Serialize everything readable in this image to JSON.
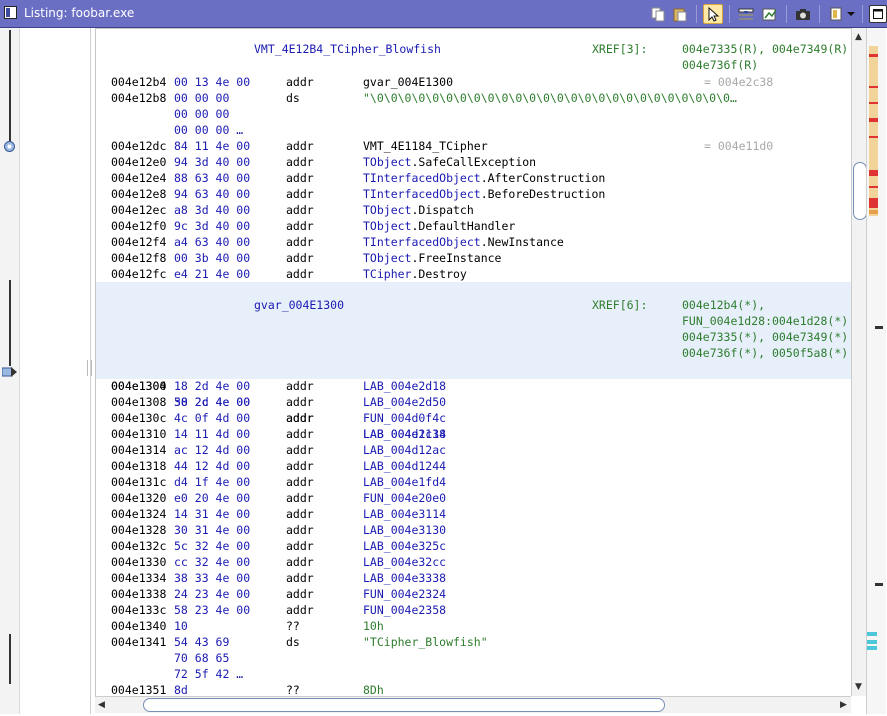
{
  "window": {
    "title": "Listing:  foobar.exe"
  },
  "toolbar": {
    "buttons": [
      {
        "name": "copy-icon"
      },
      {
        "name": "paste-icon"
      },
      {
        "name": "cursor-select-icon"
      },
      {
        "name": "edit-fields-icon"
      },
      {
        "name": "diff-icon"
      },
      {
        "name": "snapshot-icon"
      },
      {
        "name": "display-options-icon"
      },
      {
        "name": "dropdown-icon"
      },
      {
        "name": "maximize-icon"
      },
      {
        "name": "close-icon"
      }
    ]
  },
  "listing": {
    "label1": {
      "name": "VMT_4E12B4_TCipher_Blowfish",
      "xref_head": "XREF[3]:",
      "xref_lines": [
        "004e7335(R), 004e7349(R)",
        "004e736f(R)"
      ]
    },
    "rows_a": [
      {
        "addr": "004e12b4",
        "bytes": "00 13 4e 00",
        "mnem": "addr",
        "oper": "gvar_004E1300",
        "comment": "= 004e2c38"
      },
      {
        "addr": "004e12b8",
        "bytes": "00 00 00",
        "mnem": "ds",
        "oper": "\"\\0\\0\\0\\0\\0\\0\\0\\0\\0\\0\\0\\0\\0\\0\\0\\0\\0\\0\\0\\0\\0\\0\\0\\0\\0\\0…",
        "comment": ""
      },
      {
        "addr": "",
        "bytes": "00 00 00",
        "mnem": "",
        "oper": "",
        "comment": ""
      },
      {
        "addr": "",
        "bytes": "00 00 00 …",
        "mnem": "",
        "oper": "",
        "comment": ""
      },
      {
        "addr": "004e12dc",
        "bytes": "84 11 4e 00",
        "mnem": "addr",
        "oper": "VMT_4E1184_TCipher",
        "comment": "= 004e11d0"
      },
      {
        "addr": "004e12e0",
        "bytes": "94 3d 40 00",
        "mnem": "addr",
        "oper_ns": "TObject",
        "oper_fn": ".SafeCallException",
        "comment": ""
      },
      {
        "addr": "004e12e4",
        "bytes": "88 63 40 00",
        "mnem": "addr",
        "oper_ns": "TInterfacedObject",
        "oper_fn": ".AfterConstruction",
        "comment": ""
      },
      {
        "addr": "004e12e8",
        "bytes": "94 63 40 00",
        "mnem": "addr",
        "oper_ns": "TInterfacedObject",
        "oper_fn": ".BeforeDestruction",
        "comment": ""
      },
      {
        "addr": "004e12ec",
        "bytes": "a8 3d 40 00",
        "mnem": "addr",
        "oper_ns": "TObject",
        "oper_fn": ".Dispatch",
        "comment": ""
      },
      {
        "addr": "004e12f0",
        "bytes": "9c 3d 40 00",
        "mnem": "addr",
        "oper_ns": "TObject",
        "oper_fn": ".DefaultHandler",
        "comment": ""
      },
      {
        "addr": "004e12f4",
        "bytes": "a4 63 40 00",
        "mnem": "addr",
        "oper_ns": "TInterfacedObject",
        "oper_fn": ".NewInstance",
        "comment": ""
      },
      {
        "addr": "004e12f8",
        "bytes": "00 3b 40 00",
        "mnem": "addr",
        "oper_ns": "TObject",
        "oper_fn": ".FreeInstance",
        "comment": ""
      },
      {
        "addr": "004e12fc",
        "bytes": "e4 21 4e 00",
        "mnem": "addr",
        "oper_ns": "TCipher",
        "oper_fn": ".Destroy",
        "comment": ""
      }
    ],
    "label2": {
      "name": "gvar_004E1300",
      "xref_head": "XREF[6]:",
      "xref_lines": [
        "004e12b4(*),",
        "FUN_004e1d28:004e1d28(*)",
        "004e7335(*), 004e7349(*)",
        "004e736f(*), 0050f5a8(*)"
      ]
    },
    "row_hl": {
      "addr": "004e1300",
      "bytes": "38 2c 4e 00",
      "mnem": "addr",
      "oper": "LAB_004e2c38"
    },
    "rows_b": [
      {
        "addr": "004e1304",
        "bytes": "18 2d 4e 00",
        "mnem": "addr",
        "oper": "LAB_004e2d18"
      },
      {
        "addr": "004e1308",
        "bytes": "50 2d 4e 00",
        "mnem": "addr",
        "oper": "LAB_004e2d50"
      },
      {
        "addr": "004e130c",
        "bytes": "4c 0f 4d 00",
        "mnem": "addr",
        "oper": "FUN_004d0f4c"
      },
      {
        "addr": "004e1310",
        "bytes": "14 11 4d 00",
        "mnem": "addr",
        "oper": "LAB_004d1114"
      },
      {
        "addr": "004e1314",
        "bytes": "ac 12 4d 00",
        "mnem": "addr",
        "oper": "LAB_004d12ac"
      },
      {
        "addr": "004e1318",
        "bytes": "44 12 4d 00",
        "mnem": "addr",
        "oper": "LAB_004d1244"
      },
      {
        "addr": "004e131c",
        "bytes": "d4 1f 4e 00",
        "mnem": "addr",
        "oper": "LAB_004e1fd4"
      },
      {
        "addr": "004e1320",
        "bytes": "e0 20 4e 00",
        "mnem": "addr",
        "oper": "FUN_004e20e0"
      },
      {
        "addr": "004e1324",
        "bytes": "14 31 4e 00",
        "mnem": "addr",
        "oper": "LAB_004e3114"
      },
      {
        "addr": "004e1328",
        "bytes": "30 31 4e 00",
        "mnem": "addr",
        "oper": "LAB_004e3130"
      },
      {
        "addr": "004e132c",
        "bytes": "5c 32 4e 00",
        "mnem": "addr",
        "oper": "LAB_004e325c"
      },
      {
        "addr": "004e1330",
        "bytes": "cc 32 4e 00",
        "mnem": "addr",
        "oper": "LAB_004e32cc"
      },
      {
        "addr": "004e1334",
        "bytes": "38 33 4e 00",
        "mnem": "addr",
        "oper": "LAB_004e3338"
      },
      {
        "addr": "004e1338",
        "bytes": "24 23 4e 00",
        "mnem": "addr",
        "oper": "FUN_004e2324"
      },
      {
        "addr": "004e133c",
        "bytes": "58 23 4e 00",
        "mnem": "addr",
        "oper": "FUN_004e2358"
      },
      {
        "addr": "004e1340",
        "bytes": "10",
        "mnem": "??",
        "oper": "10h",
        "type": "str"
      },
      {
        "addr": "004e1341",
        "bytes": "54 43 69",
        "mnem": "ds",
        "oper": "\"TCipher_Blowfish\"",
        "type": "str"
      },
      {
        "addr": "",
        "bytes": "70 68 65",
        "mnem": "",
        "oper": ""
      },
      {
        "addr": "",
        "bytes": "72 5f 42 …",
        "mnem": "",
        "oper": ""
      },
      {
        "addr": "004e1351",
        "bytes": "8d",
        "mnem": "??",
        "oper": "8Dh",
        "type": "str"
      }
    ]
  },
  "colors": {
    "titlebar": "#6b6fc4",
    "highlight": "#e6effa",
    "bytes": "#1a1ab3",
    "xref": "#2e7d2e",
    "comment": "#a9a9a9"
  }
}
